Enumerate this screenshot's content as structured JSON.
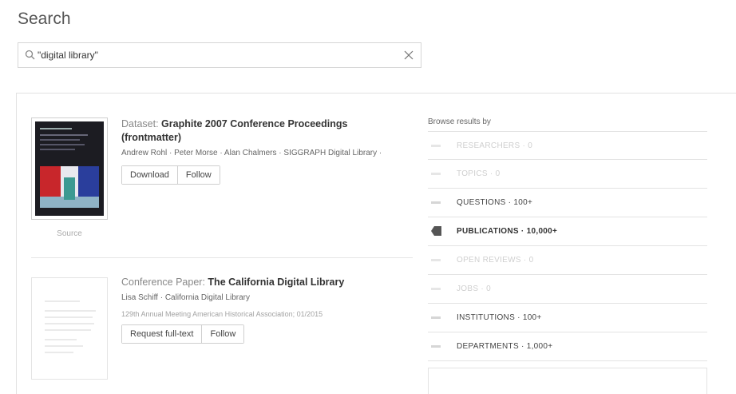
{
  "page": {
    "title": "Search"
  },
  "search": {
    "value": "\"digital library\"",
    "placeholder": ""
  },
  "results": [
    {
      "type_label": "Dataset:",
      "title": "Graphite 2007 Conference Proceedings (frontmatter)",
      "authors": "Andrew Rohl · Peter Morse · Alan Chalmers · SIGGRAPH Digital Library ·",
      "thumb_caption": "Source",
      "buttons": {
        "primary": "Download",
        "secondary": "Follow"
      }
    },
    {
      "type_label": "Conference Paper:",
      "title": "The California Digital Library",
      "authors": "Lisa Schiff · California Digital Library",
      "venue": "129th Annual Meeting American Historical Association; 01/2015",
      "buttons": {
        "primary": "Request full-text",
        "secondary": "Follow"
      }
    }
  ],
  "browse": {
    "title": "Browse results by",
    "items": [
      {
        "label": "RESEARCHERS · 0",
        "state": "disabled"
      },
      {
        "label": "TOPICS · 0",
        "state": "disabled"
      },
      {
        "label": "QUESTIONS · 100+",
        "state": "normal"
      },
      {
        "label": "PUBLICATIONS · 10,000+",
        "state": "active"
      },
      {
        "label": "OPEN REVIEWS · 0",
        "state": "disabled"
      },
      {
        "label": "JOBS · 0",
        "state": "disabled"
      },
      {
        "label": "INSTITUTIONS · 100+",
        "state": "normal"
      },
      {
        "label": "DEPARTMENTS · 1,000+",
        "state": "normal"
      }
    ]
  },
  "colors": {
    "text": "#333333",
    "muted": "#888888",
    "disabled": "#cfcfcf",
    "border": "#e3e3e3"
  }
}
